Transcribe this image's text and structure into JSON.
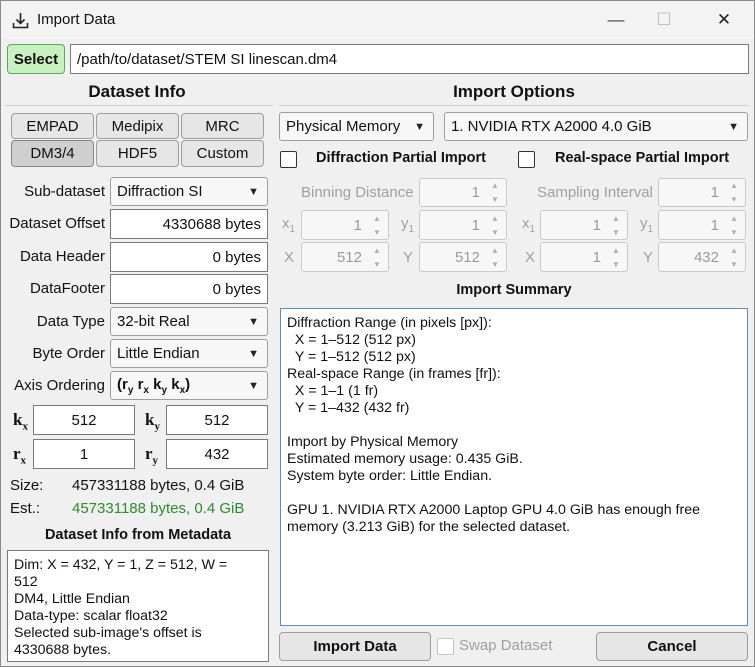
{
  "window": {
    "title": "Import Data",
    "minimize": "—",
    "maximize": "☐",
    "close": "✕"
  },
  "file": {
    "select_label": "Select",
    "path": "/path/to/dataset/STEM SI linescan.dm4"
  },
  "dataset_info": {
    "heading": "Dataset Info",
    "formats": [
      "EMPAD",
      "Medipix",
      "MRC",
      "DM3/4",
      "HDF5",
      "Custom"
    ],
    "sub_dataset_label": "Sub-dataset",
    "sub_dataset_value": "Diffraction SI",
    "offset_label": "Dataset Offset",
    "offset_value": "4330688 bytes",
    "header_label": "Data Header",
    "header_value": "0 bytes",
    "footer_label": "DataFooter",
    "footer_value": "0 bytes",
    "type_label": "Data Type",
    "type_value": "32-bit Real",
    "byte_order_label": "Byte Order",
    "byte_order_value": "Little Endian",
    "axis_label": "Axis Ordering",
    "kx": {
      "sym": "k",
      "sub": "x",
      "value": "512"
    },
    "ky": {
      "sym": "k",
      "sub": "y",
      "value": "512"
    },
    "rx": {
      "sym": "r",
      "sub": "x",
      "value": "1"
    },
    "ry": {
      "sym": "r",
      "sub": "y",
      "value": "432"
    },
    "size_label": "Size:",
    "size_value": "457331188 bytes, 0.4 GiB",
    "est_label": "Est.:",
    "est_value": "457331188 bytes, 0.4 GiB",
    "est_color": "#2e8b2e",
    "metadata_heading": "Dataset Info from Metadata",
    "metadata_text": "Dim: X = 432, Y = 1, Z = 512, W =\n512\nDM4, Little Endian\nData-type: scalar float32\nSelected sub-image's offset is\n4330688 bytes."
  },
  "import_options": {
    "heading": "Import Options",
    "memory_value": "Physical Memory",
    "gpu_value": "1. NVIDIA RTX A2000 4.0 GiB",
    "diff_partial": "Diffraction Partial Import",
    "real_partial": "Real-space Partial Import",
    "binning_label": "Binning Distance",
    "binning_value": "1",
    "sampling_label": "Sampling Interval",
    "sampling_value": "1",
    "x1": "x",
    "y1": "y",
    "one": "1",
    "x": "X",
    "y": "Y",
    "diff_x1": "1",
    "diff_y1": "1",
    "diff_X": "512",
    "diff_Y": "512",
    "real_x1": "1",
    "real_y1": "1",
    "real_X": "1",
    "real_Y": "432",
    "summary_heading": "Import Summary",
    "summary_text": "Diffraction Range (in pixels [px]):\n  X = 1–512 (512 px)\n  Y = 1–512 (512 px)\nReal-space Range (in frames [fr]):\n  X = 1–1 (1 fr)\n  Y = 1–432 (432 fr)\n\nImport by Physical Memory\nEstimated memory usage: 0.435 GiB.\nSystem byte order: Little Endian.\n\nGPU 1. NVIDIA RTX A2000 Laptop GPU 4.0 GiB has enough free\nmemory (3.213 GiB) for the selected dataset."
  },
  "footer": {
    "import_label": "Import Data",
    "swap_label": "Swap Dataset",
    "cancel_label": "Cancel"
  },
  "icons": {
    "import": "download-icon",
    "dropdown": "chevron-down-icon",
    "spin_up": "spin-up-icon",
    "spin_down": "spin-down-icon"
  },
  "colors": {
    "select_button": "#c8f0c0",
    "select_border": "#5aa85a",
    "summary_border": "#5b8dc9"
  }
}
